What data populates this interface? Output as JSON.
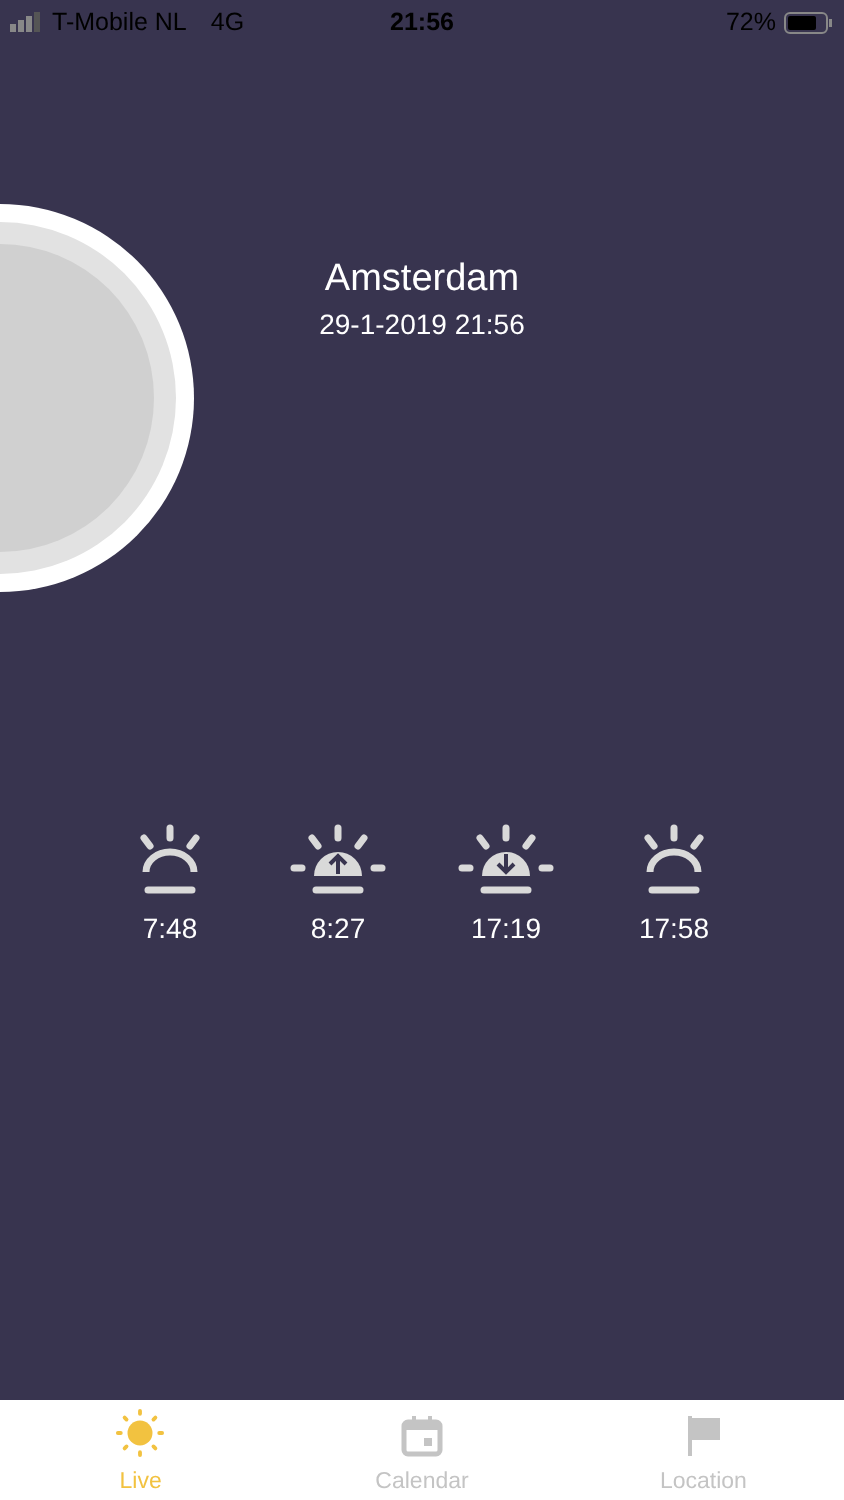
{
  "status_bar": {
    "carrier": "T-Mobile NL",
    "network": "4G",
    "time": "21:56",
    "battery": "72%"
  },
  "location": {
    "city": "Amsterdam",
    "datetime": "29-1-2019 21:56"
  },
  "sun_events": [
    {
      "kind": "twilight",
      "time": "7:48"
    },
    {
      "kind": "sunrise",
      "time": "8:27"
    },
    {
      "kind": "sunset",
      "time": "17:19"
    },
    {
      "kind": "twilight",
      "time": "17:58"
    }
  ],
  "tabs": [
    {
      "kind": "sun",
      "label": "Live",
      "selected": true
    },
    {
      "kind": "calendar",
      "label": "Calendar",
      "selected": false
    },
    {
      "kind": "flag",
      "label": "Location",
      "selected": false
    }
  ]
}
